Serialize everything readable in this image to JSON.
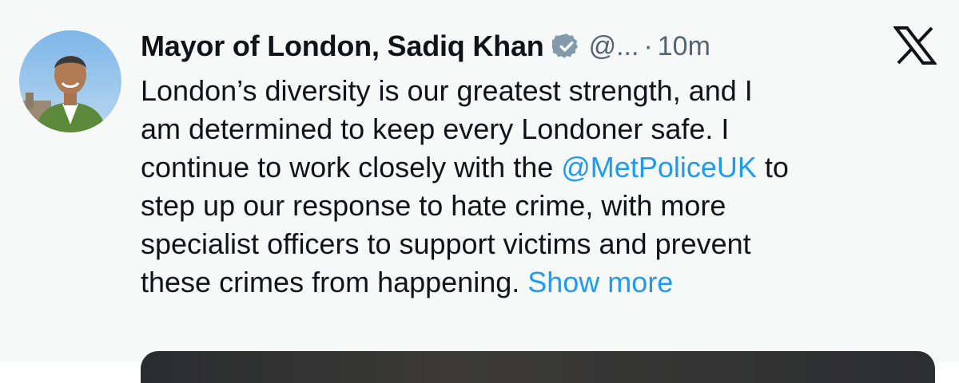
{
  "tweet": {
    "display_name": "Mayor of London, Sadiq Khan",
    "handle": "@...",
    "separator": "·",
    "time": "10m",
    "text_lines": [
      [
        "London’s diversity is our greatest strength, and I"
      ],
      [
        "am determined to keep every Londoner safe. I"
      ],
      [
        "continue to work closely with the ",
        "@MetPoliceUK",
        " to"
      ],
      [
        "step up our response to hate crime, with more"
      ],
      [
        "specialist officers to support victims and prevent"
      ],
      [
        "these crimes from happening. ",
        "Show more"
      ]
    ],
    "icons": {
      "avatar": "profile-photo",
      "verified": "verified-badge-icon",
      "brand": "x-logo-icon"
    },
    "colors": {
      "text": "#0f1419",
      "secondary": "#536471",
      "link": "#1d9bf0",
      "background": "#f7f9f9"
    }
  }
}
